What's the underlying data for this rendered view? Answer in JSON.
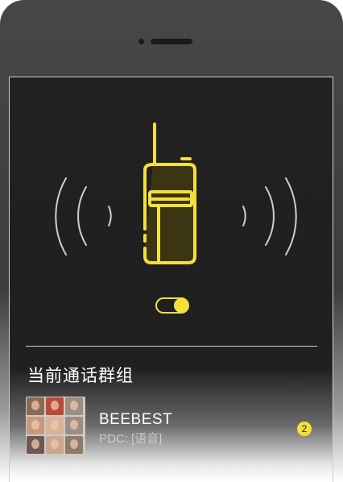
{
  "hero": {
    "radio_icon": "walkie-talkie-icon",
    "signal_icon": "signal-waves-icon",
    "toggle_on": true,
    "accent": "#f5e03a"
  },
  "current_group": {
    "title": "当前通话群组",
    "chevron_icon": "chevron-down-icon",
    "group": {
      "name": "BEEBEST",
      "subtitle": "PDC: [语音]",
      "badge": "2",
      "avatar_icon": "group-avatar-icon",
      "avatar_colors": [
        "#8a6a55",
        "#b84a3a",
        "#9c8c84",
        "#c49a80",
        "#d8b39a",
        "#9a8f88",
        "#6b5a52",
        "#c7a98f",
        "#8c7a6a"
      ]
    }
  }
}
